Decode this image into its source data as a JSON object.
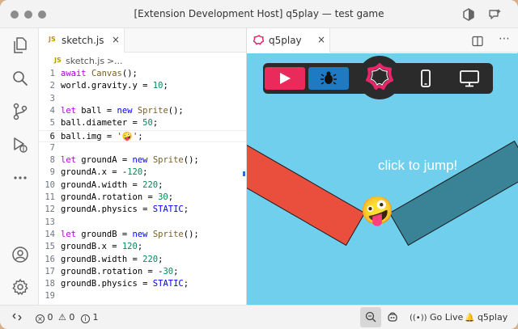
{
  "window": {
    "title": "[Extension Development Host] q5play — test game"
  },
  "editor": {
    "tab_label": "sketch.js",
    "tab_badge": "JS",
    "breadcrumb_file": "sketch.js",
    "breadcrumb_sep": ">",
    "breadcrumb_more": "...",
    "lines": [
      {
        "n": "1",
        "t": "await Canvas();"
      },
      {
        "n": "2",
        "t": "world.gravity.y = 10;"
      },
      {
        "n": "3",
        "t": ""
      },
      {
        "n": "4",
        "t": "let ball = new Sprite();"
      },
      {
        "n": "5",
        "t": "ball.diameter = 50;"
      },
      {
        "n": "6",
        "t": "ball.img = '🤪';"
      },
      {
        "n": "7",
        "t": ""
      },
      {
        "n": "8",
        "t": "let groundA = new Sprite();"
      },
      {
        "n": "9",
        "t": "groundA.x = -120;"
      },
      {
        "n": "10",
        "t": "groundA.width = 220;"
      },
      {
        "n": "11",
        "t": "groundA.rotation = 30;"
      },
      {
        "n": "12",
        "t": "groundA.physics = STATIC;"
      },
      {
        "n": "13",
        "t": ""
      },
      {
        "n": "14",
        "t": "let groundB = new Sprite();"
      },
      {
        "n": "15",
        "t": "groundB.x = 120;"
      },
      {
        "n": "16",
        "t": "groundB.width = 220;"
      },
      {
        "n": "17",
        "t": "groundB.rotation = -30;"
      },
      {
        "n": "18",
        "t": "groundB.physics = STATIC;"
      },
      {
        "n": "19",
        "t": ""
      }
    ]
  },
  "preview": {
    "tab_label": "q5play",
    "canvas_text": "click to jump!",
    "ball_emoji": "🤪",
    "colors": {
      "background": "#70cfed",
      "ground_a": "#e94f3c",
      "ground_b": "#3a8296",
      "play_button": "#ea2a5a",
      "debug_button": "#1f7ac4"
    }
  },
  "status": {
    "errors": "0",
    "warnings": "0",
    "info": "1",
    "go_live": "Go Live",
    "q5play": "q5play"
  }
}
